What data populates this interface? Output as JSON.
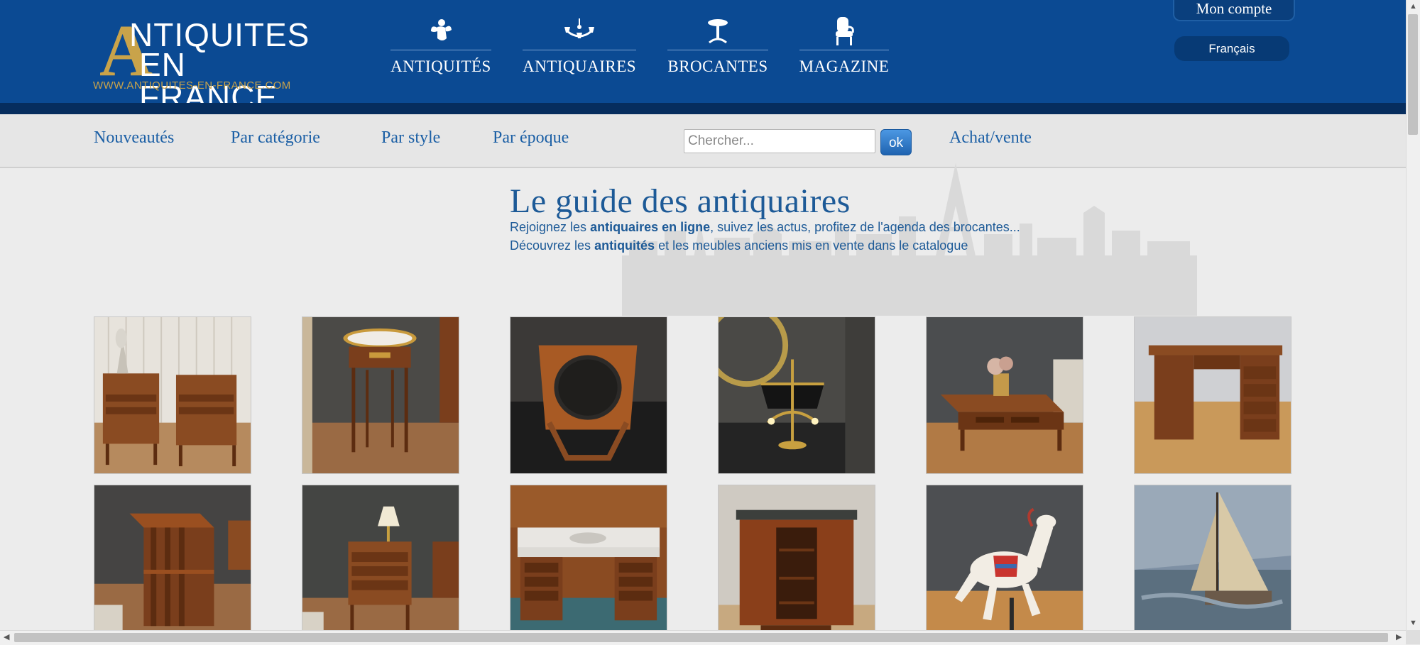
{
  "logo": {
    "big_letter": "A",
    "line1": "NTIQUITES",
    "line2": "EN FRANCE",
    "url": "WWW.ANTIQUITES-EN-FRANCE.COM"
  },
  "main_nav": [
    {
      "label": "ANTIQUITÉS",
      "icon": "angel-icon"
    },
    {
      "label": "ANTIQUAIRES",
      "icon": "chandelier-icon"
    },
    {
      "label": "BROCANTES",
      "icon": "pedestal-table-icon"
    },
    {
      "label": "MAGAZINE",
      "icon": "armchair-icon"
    }
  ],
  "account": {
    "label": "Mon compte"
  },
  "language": {
    "label": "Français"
  },
  "sub_nav": {
    "items": [
      "Nouveautés",
      "Par catégorie",
      "Par style",
      "Par époque"
    ],
    "search_placeholder": "Chercher...",
    "search_button": "ok",
    "achat_vente": "Achat/vente"
  },
  "hero": {
    "title": "Le guide des antiquaires",
    "line1": {
      "pre": "Rejoignez les ",
      "bold": "antiquaires en ligne",
      "post": ", suivez les actus, profitez de l'agenda des brocantes..."
    },
    "line2": {
      "pre": "Découvrez les ",
      "bold": "antiquités",
      "post": " et les meubles anciens mis en vente dans le catalogue"
    }
  },
  "gallery": [
    {
      "name": "pair-of-bedside-tables"
    },
    {
      "name": "round-side-table"
    },
    {
      "name": "dressing-mirror-stand"
    },
    {
      "name": "bouillotte-lamp"
    },
    {
      "name": "coffee-table"
    },
    {
      "name": "pedestal-desk"
    },
    {
      "name": "revolving-bookcase"
    },
    {
      "name": "small-chest-of-drawers"
    },
    {
      "name": "marble-top-washstand"
    },
    {
      "name": "art-deco-cabinet"
    },
    {
      "name": "carousel-horse"
    },
    {
      "name": "sailboat-painting"
    }
  ],
  "colors": {
    "header_blue": "#0b4a93",
    "gold": "#c9a34a",
    "link_blue": "#1b5fa5"
  }
}
